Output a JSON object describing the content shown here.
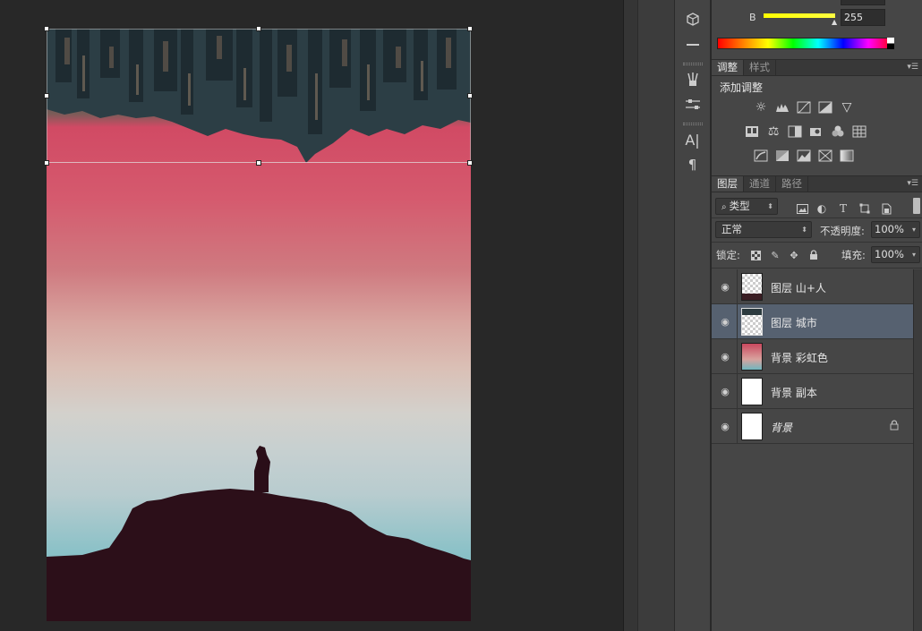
{
  "color_panel": {
    "channel_label": "B",
    "channel_value": "255"
  },
  "adjustments": {
    "tabs": [
      "调整",
      "样式"
    ],
    "title": "添加调整",
    "icons_row1": [
      "brightness-icon",
      "levels-icon",
      "curves-icon",
      "exposure-icon",
      "vibrance-icon"
    ],
    "icons_row2": [
      "hue-saturation-icon",
      "color-balance-icon",
      "black-white-icon",
      "photo-filter-icon",
      "channel-mixer-icon",
      "color-lookup-icon"
    ],
    "icons_row3": [
      "invert-icon",
      "posterize-icon",
      "threshold-icon",
      "selective-color-icon",
      "gradient-map-icon"
    ]
  },
  "layers_panel": {
    "tabs": [
      "图层",
      "通道",
      "路径"
    ],
    "filter_kind": "类型",
    "blend_mode": "正常",
    "opacity_label": "不透明度:",
    "opacity_value": "100%",
    "lock_label": "锁定:",
    "fill_label": "填充:",
    "fill_value": "100%",
    "layers": [
      {
        "name": "图层 山+人",
        "thumb": "checker-mountain",
        "selected": false,
        "locked": false
      },
      {
        "name": "图层 城市",
        "thumb": "checker-city",
        "selected": true,
        "locked": false
      },
      {
        "name": "背景 彩虹色",
        "thumb": "rainbow",
        "selected": false,
        "locked": false
      },
      {
        "name": "背景 副本",
        "thumb": "white",
        "selected": false,
        "locked": false
      },
      {
        "name": "背景",
        "thumb": "white",
        "selected": false,
        "locked": true
      }
    ]
  },
  "colors": {
    "selected_layer": "#566170",
    "panel_bg": "#464646",
    "workspace_bg": "#282828"
  }
}
